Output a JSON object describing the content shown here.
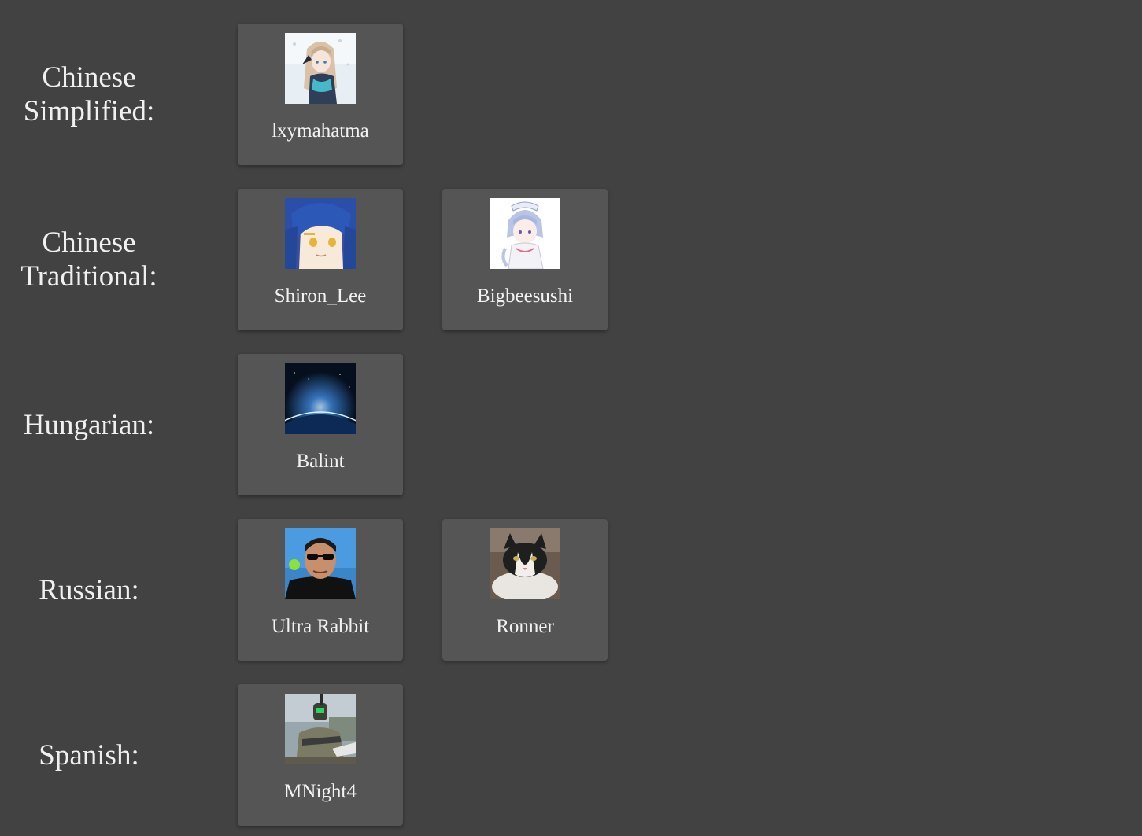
{
  "sections": [
    {
      "label_lines": [
        "Chinese",
        "Simplified:"
      ],
      "members": [
        {
          "name": "lxymahatma",
          "avatar_icon": "anime-girl-snow-avatar-icon"
        }
      ]
    },
    {
      "label_lines": [
        "Chinese",
        "Traditional:"
      ],
      "members": [
        {
          "name": "Shiron_Lee",
          "avatar_icon": "anime-girl-blue-hair-avatar-icon"
        },
        {
          "name": "Bigbeesushi",
          "avatar_icon": "anime-maid-avatar-icon"
        }
      ]
    },
    {
      "label_lines": [
        "Hungarian:"
      ],
      "members": [
        {
          "name": "Balint",
          "avatar_icon": "earth-from-space-avatar-icon"
        }
      ]
    },
    {
      "label_lines": [
        "Russian:"
      ],
      "members": [
        {
          "name": "Ultra Rabbit",
          "avatar_icon": "man-sunglasses-avatar-icon"
        },
        {
          "name": "Ronner",
          "avatar_icon": "cat-avatar-icon"
        }
      ]
    },
    {
      "label_lines": [
        "Spanish:"
      ],
      "members": [
        {
          "name": "MNight4",
          "avatar_icon": "armored-soldier-avatar-icon"
        }
      ]
    }
  ],
  "colors": {
    "background": "#424242",
    "card": "#555555",
    "text": "#f0f0f0"
  }
}
